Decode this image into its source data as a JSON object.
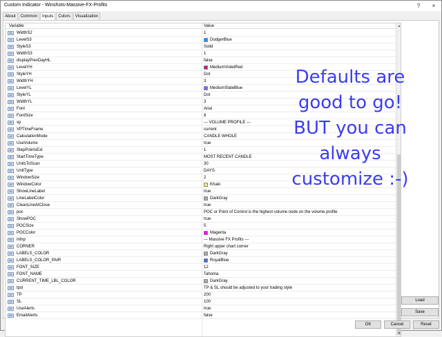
{
  "window": {
    "title": "Custom Indicator - Winshots-Massive-FX-Profits",
    "help_label": "?",
    "close_label": "×"
  },
  "tabs": [
    {
      "label": "About"
    },
    {
      "label": "Common"
    },
    {
      "label": "Inputs",
      "active": true
    },
    {
      "label": "Colors"
    },
    {
      "label": "Visualization"
    }
  ],
  "grid": {
    "col_variable": "Variable",
    "col_value": "Value",
    "rows": [
      {
        "icon": "ab",
        "name": "WidthS2",
        "value": "1"
      },
      {
        "icon": "ab",
        "name": "LevelS3",
        "value": "DodgerBlue",
        "swatch": "#1e90ff"
      },
      {
        "icon": "ab",
        "name": "StyleS3",
        "value": "Solid"
      },
      {
        "icon": "ab",
        "name": "WidthS3",
        "value": "1"
      },
      {
        "icon": "ab",
        "name": "displayPrevDayHL",
        "value": "false"
      },
      {
        "icon": "ab",
        "name": "LevelYH",
        "value": "MediumVioletRed",
        "swatch": "#c71585"
      },
      {
        "icon": "ab",
        "name": "StyleYH",
        "value": "Dot"
      },
      {
        "icon": "ab",
        "name": "WidthYH",
        "value": "3"
      },
      {
        "icon": "ab",
        "name": "LevelYL",
        "value": "MediumSlateBlue",
        "swatch": "#7b68ee"
      },
      {
        "icon": "ab",
        "name": "StyleYL",
        "value": "Dot"
      },
      {
        "icon": "ab",
        "name": "WidthYL",
        "value": "3"
      },
      {
        "icon": "ab",
        "name": "Font",
        "value": "Arial"
      },
      {
        "icon": "ab",
        "name": "FontSize",
        "value": "8"
      },
      {
        "icon": "ab",
        "name": "vp",
        "value": "--- VOLUME PROFILE ---"
      },
      {
        "icon": "ab",
        "name": "VPTimeFrame",
        "value": "current"
      },
      {
        "icon": "ab",
        "name": "CalculationMode",
        "value": "CANDLE WHOLE"
      },
      {
        "icon": "ab",
        "name": "UseVolume",
        "value": "true"
      },
      {
        "icon": "ab",
        "name": "StepPointsExt",
        "value": "1"
      },
      {
        "icon": "ab",
        "name": "StartTimeType",
        "value": "MOST RECENT CANDLE"
      },
      {
        "icon": "ab",
        "name": "UnitsToScan",
        "value": "30"
      },
      {
        "icon": "ab",
        "name": "UnitType",
        "value": "DAYS"
      },
      {
        "icon": "ab",
        "name": "WindowSize",
        "value": "2"
      },
      {
        "icon": "ab",
        "name": "WindowColor",
        "value": "Khaki",
        "swatch": "#f0e68c"
      },
      {
        "icon": "ab",
        "name": "ShowLineLabel",
        "value": "true"
      },
      {
        "icon": "ab",
        "name": "LineLabelColor",
        "value": "DarkGray",
        "swatch": "#a9a9a9"
      },
      {
        "icon": "ab",
        "name": "CleanLineAtClose",
        "value": "true"
      },
      {
        "icon": "ab",
        "name": "poc",
        "value": "POC or Point of Control is the highest volume node on the volume profile"
      },
      {
        "icon": "ab",
        "name": "ShowPOC",
        "value": "true"
      },
      {
        "icon": "ab",
        "name": "POCSize",
        "value": "5"
      },
      {
        "icon": "ab",
        "name": "POCColor",
        "value": "Magenta",
        "swatch": "#ff00ff"
      },
      {
        "icon": "ab",
        "name": "mfxp",
        "value": "--- Massive FX Profits ---"
      },
      {
        "icon": "ab",
        "name": "CORNER",
        "value": "Right upper chart corner"
      },
      {
        "icon": "ab",
        "name": "LABELS_COLOR",
        "value": "DarkGray",
        "swatch": "#a9a9a9"
      },
      {
        "icon": "ab",
        "name": "LABELS_COLOR_PAIR",
        "value": "RoyalBlue",
        "swatch": "#4169e1"
      },
      {
        "icon": "ab",
        "name": "FONT_SIZE",
        "value": "12"
      },
      {
        "icon": "ab",
        "name": "FONT_NAME",
        "value": "Tahoma"
      },
      {
        "icon": "ab",
        "name": "CURRENT_TIME_LBL_COLOR",
        "value": "DarkGray",
        "swatch": "#a9a9a9"
      },
      {
        "icon": "ab",
        "name": "tpsl",
        "value": "TP & SL should be adjusted to your trading style"
      },
      {
        "icon": "ab",
        "name": "TP",
        "value": "200"
      },
      {
        "icon": "ab",
        "name": "SL",
        "value": "100"
      },
      {
        "icon": "ab",
        "name": "UseAlerts",
        "value": "true"
      },
      {
        "icon": "ab",
        "name": "EmailAlerts",
        "value": "false"
      }
    ]
  },
  "overlay": {
    "lines": [
      "Defaults are",
      "good to go!",
      "BUT you can",
      "always",
      "customize :-)"
    ],
    "color": "#3c3cf0"
  },
  "buttons": {
    "load": "Load",
    "save": "Save",
    "ok": "OK",
    "cancel": "Cancel",
    "reset": "Reset"
  }
}
